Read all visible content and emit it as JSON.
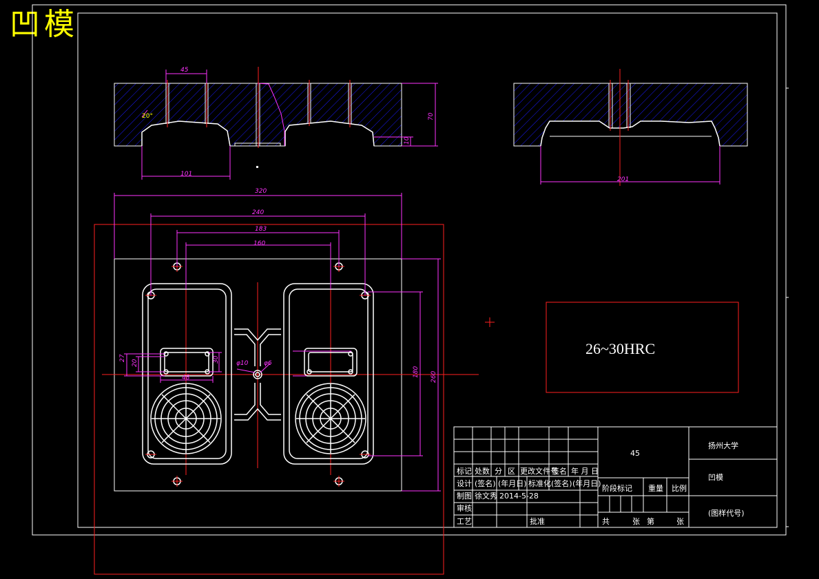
{
  "title": "凹模",
  "hardness_note": "26~30HRC",
  "dimensions": {
    "d45": "45",
    "d70": "70",
    "d10": "10",
    "d101": "101",
    "d20deg": "20°",
    "d201": "201",
    "d320": "320",
    "d240": "240",
    "d183": "183",
    "d160": "160",
    "d180": "180",
    "d260": "260",
    "d27": "27",
    "d20": "20",
    "d30": "30",
    "d48": "48",
    "phi10": "φ10",
    "phi6": "φ6"
  },
  "title_block": {
    "material": "45",
    "school": "扬州大学",
    "part_name": "凹模",
    "drawing_code": "(图样代号)",
    "row_headers": [
      "标记",
      "处数",
      "分",
      "区",
      "更改文件号",
      "签名",
      "年 月 日"
    ],
    "design_label": "设计",
    "design_sign": "(签名)",
    "design_date": "(年月日)",
    "standardize_label": "标准化",
    "standardize_sign": "(签名)",
    "standardize_date": "(年月日)",
    "draw_label": "制图",
    "draw_name": "徐文秀",
    "draw_date": "2014-5-28",
    "check_label": "审核",
    "process_label": "工艺",
    "approve_label": "批准",
    "stage_label": "阶段标记",
    "weight_label": "重量",
    "scale_label": "比例",
    "sheets_total": "共",
    "sheets_unit": "张",
    "sheet_no": "第",
    "sheet_unit2": "张"
  },
  "colors": {
    "background": "#000000",
    "outline": "#ffffff",
    "dimension": "#ff33ff",
    "centerline": "#ff2020",
    "hatch": "#1a1aff",
    "title_text": "#ffff00"
  }
}
